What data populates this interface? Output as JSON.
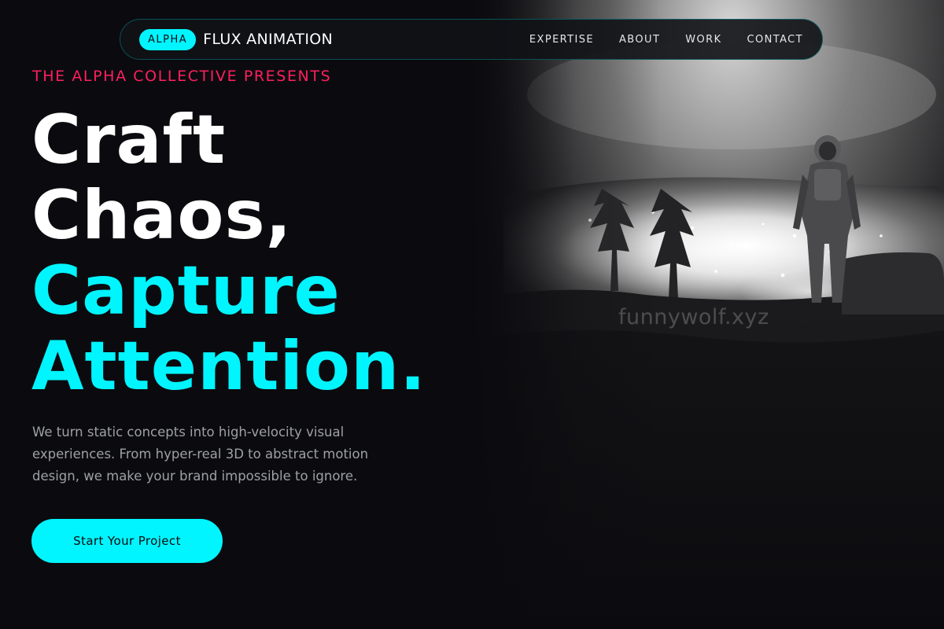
{
  "navbar": {
    "badge": "ALPHA",
    "brand": "FLUX ANIMATION",
    "links": [
      "EXPERTISE",
      "ABOUT",
      "WORK",
      "CONTACT"
    ]
  },
  "hero": {
    "eyebrow": "THE ALPHA COLLECTIVE PRESENTS",
    "headline": {
      "line1": "Craft",
      "line2": "Chaos,",
      "line3": "Capture",
      "line4": "Attention."
    },
    "description": "We turn static concepts into high-velocity visual experiences. From hyper-real 3D to abstract motion design, we make your brand impossible to ignore.",
    "cta_label": "Start Your Project",
    "image_watermark": "funnywolf.xyz"
  },
  "colors": {
    "accent": "#00f5ff",
    "eyebrow": "#ff1f5e",
    "background": "#0b0b0f"
  }
}
